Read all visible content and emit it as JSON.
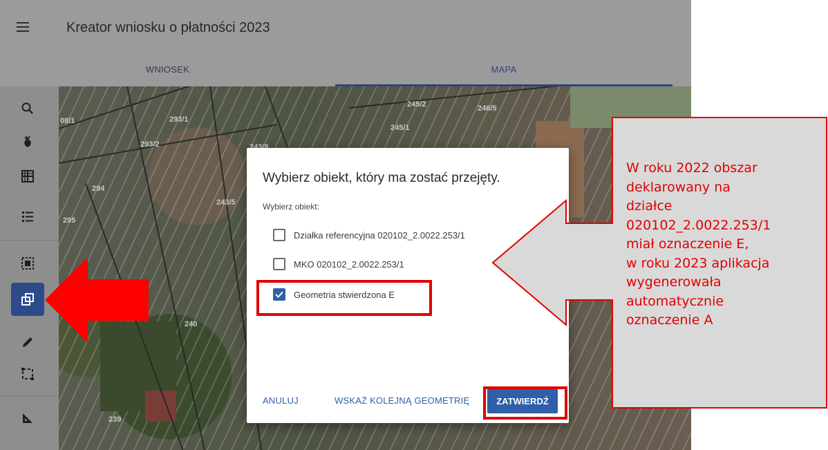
{
  "header": {
    "title": "Kreator wniosku o płatności 2023"
  },
  "tabs": [
    {
      "label": "WNIOSEK"
    },
    {
      "label": "MAPA",
      "active": true
    }
  ],
  "toolbar": {
    "tools": [
      {
        "icon": "search-icon"
      },
      {
        "icon": "crop-icon"
      },
      {
        "icon": "grid-icon"
      },
      {
        "icon": "list-icon"
      },
      {
        "icon": "select-area-icon"
      },
      {
        "icon": "copy-geometry-icon",
        "active": true
      },
      {
        "icon": "pencil-icon"
      },
      {
        "icon": "dashed-rectangle-icon"
      },
      {
        "icon": "ruler-triangle-icon"
      }
    ]
  },
  "map": {
    "parcel_labels": [
      "08/1",
      "293/1",
      "293/2",
      "294",
      "295",
      "243/5",
      "243/8",
      "245/2",
      "245/1",
      "246/5",
      "240",
      "239"
    ]
  },
  "dialog": {
    "title": "Wybierz obiekt, który ma zostać przejęty.",
    "subtitle": "Wybierz obiekt:",
    "options": [
      {
        "label": "Działka referencyjna 020102_2.0022.253/1",
        "checked": false
      },
      {
        "label": "MKO 020102_2.0022.253/1",
        "checked": false
      },
      {
        "label": "Geometria stwierdzona E",
        "checked": true
      }
    ],
    "cancel_label": "ANULUJ",
    "next_label": "WSKAŻ KOLEJNĄ GEOMETRIĘ",
    "confirm_label": "ZATWIERDŹ"
  },
  "callout": {
    "lines": [
      "W roku 2022 obszar",
      "deklarowany na",
      "działce",
      "020102_2.0022.253/1",
      "miał oznaczenie E,",
      "w roku 2023 aplikacja",
      "wygenerowała",
      "automatycznie",
      "oznaczenie A"
    ]
  },
  "colors": {
    "primary": "#2e5fa8",
    "active_tool": "#2e4a8a",
    "annotation_red": "#e00000",
    "callout_fill": "#d9d9d9"
  }
}
